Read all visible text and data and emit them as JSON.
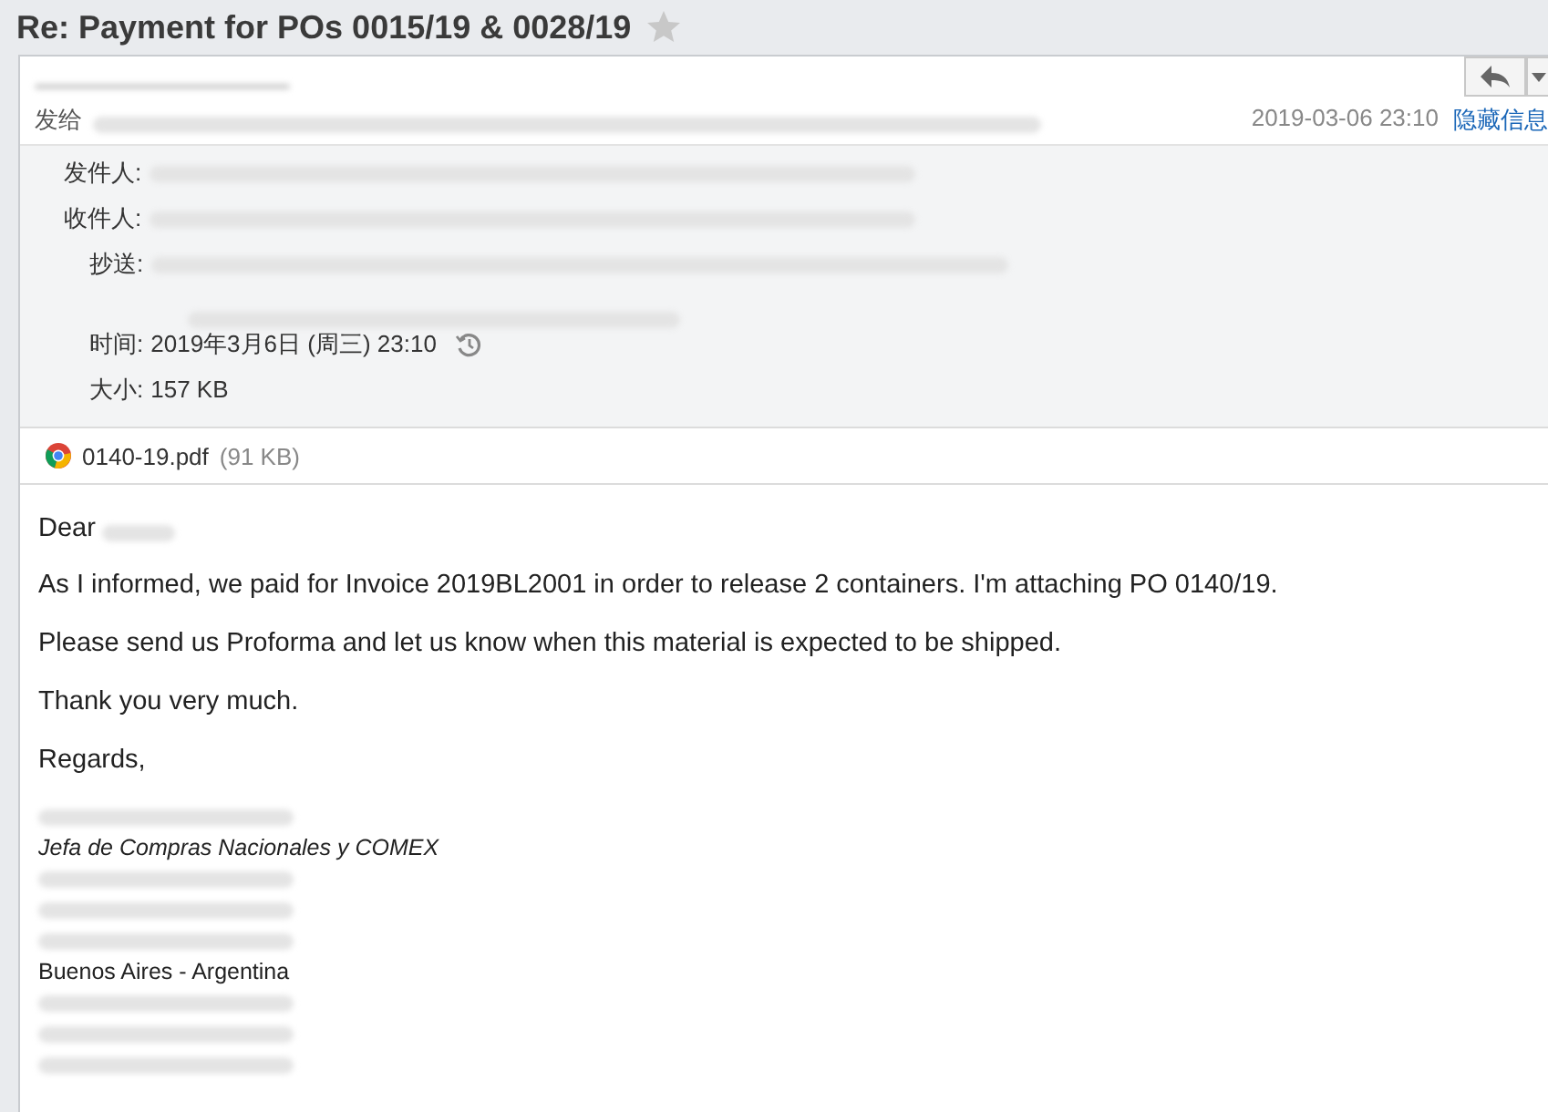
{
  "title": "Re: Payment for POs 0015/19 & 0028/19",
  "starred": false,
  "header": {
    "to_label": "发给",
    "date": "2019-03-06 23:10",
    "hide_details_link": "隐藏信息"
  },
  "details": [
    {
      "label": "发件人:",
      "kind": "redacted"
    },
    {
      "label": "收件人:",
      "kind": "redacted"
    },
    {
      "label": "抄送:",
      "kind": "redacted2"
    },
    {
      "label": "时间:",
      "kind": "time",
      "value": "2019年3月6日 (周三) 23:10"
    },
    {
      "label": "大小:",
      "kind": "text",
      "value": "157 KB"
    }
  ],
  "attachment": {
    "name": "0140-19.pdf",
    "size": "(91 KB)"
  },
  "greeting": "Dear",
  "paragraphs": [
    "As I informed, we paid for Invoice 2019BL2001 in order to release 2 containers. I'm attaching PO 0140/19.",
    "Please send us Proforma and let us know when this material is expected to be shipped.",
    "Thank you very much.",
    "Regards,"
  ],
  "signature": [
    {
      "kind": "redacted"
    },
    {
      "kind": "italic",
      "text": "Jefa de Compras Nacionales y COMEX"
    },
    {
      "kind": "redacted"
    },
    {
      "kind": "redacted"
    },
    {
      "kind": "redacted"
    },
    {
      "kind": "plain",
      "text": "Buenos Aires - Argentina"
    },
    {
      "kind": "redacted"
    },
    {
      "kind": "redacted"
    },
    {
      "kind": "redacted"
    }
  ]
}
